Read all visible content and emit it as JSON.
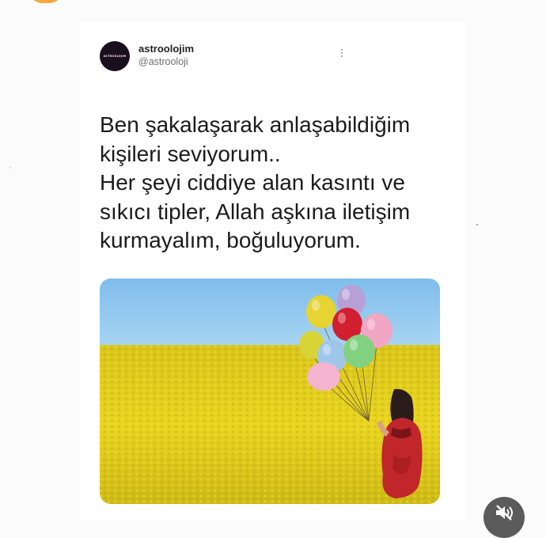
{
  "tweet": {
    "display_name": "astroolojim",
    "handle": "@astrooloji",
    "avatar_text": "ASTROOLOJIM",
    "text_lines": [
      "Ben şakalaşarak anlaşabildiğim",
      "kişileri seviyorum..",
      "Her şeyi ciddiye alan kasıntı ve",
      "sıkıcı tipler, Allah aşkına iletişim",
      "kurmayalım, boğuluyorum."
    ],
    "more_icon": "more-vertical-icon",
    "image": "woman-in-red-with-balloons-in-yellow-field"
  },
  "controls": {
    "mute_icon": "volume-muted-icon"
  },
  "colors": {
    "sky": "#8ec6ef",
    "field": "#e6d21a",
    "dress": "#c0262a",
    "mute_bg": "#5b5b5b",
    "avatar_bg": "#1a0f1f"
  }
}
